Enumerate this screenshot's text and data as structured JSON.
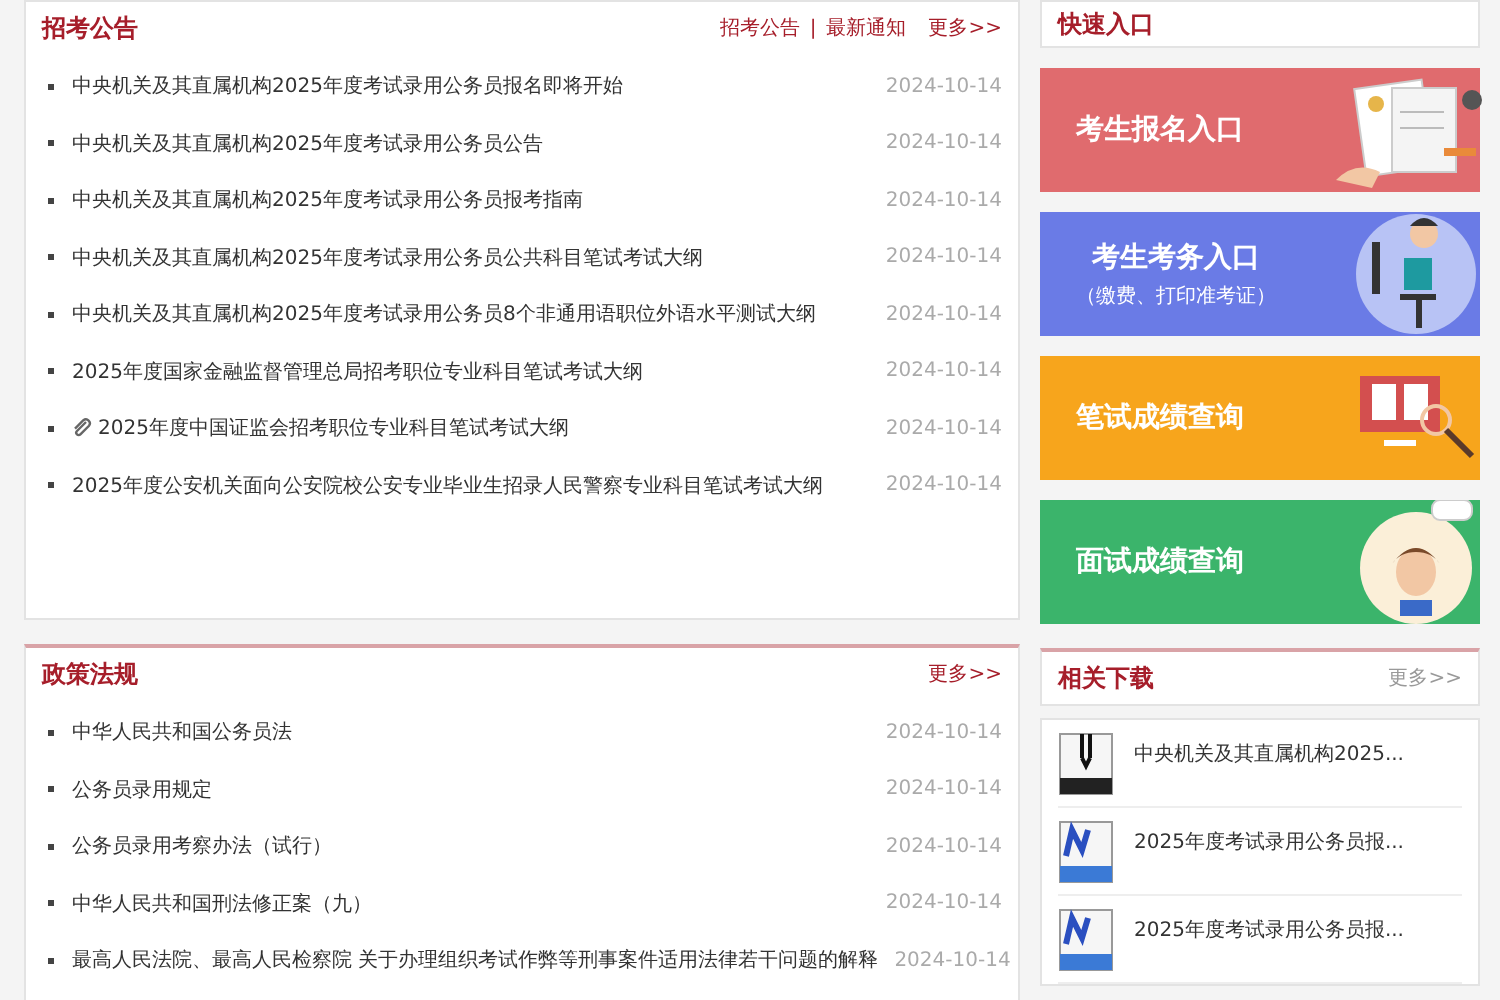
{
  "announcements": {
    "title": "招考公告",
    "links": [
      {
        "label": "招考公告"
      },
      {
        "label": "最新通知"
      }
    ],
    "separator": "|",
    "more": "更多>>",
    "items": [
      {
        "title": "中央机关及其直属机构2025年度考试录用公务员报名即将开始",
        "date": "2024-10-14",
        "attachment": false
      },
      {
        "title": "中央机关及其直属机构2025年度考试录用公务员公告",
        "date": "2024-10-14",
        "attachment": false
      },
      {
        "title": "中央机关及其直属机构2025年度考试录用公务员报考指南",
        "date": "2024-10-14",
        "attachment": false
      },
      {
        "title": "中央机关及其直属机构2025年度考试录用公务员公共科目笔试考试大纲",
        "date": "2024-10-14",
        "attachment": false
      },
      {
        "title": "中央机关及其直属机构2025年度考试录用公务员8个非通用语职位外语水平测试大纲",
        "date": "2024-10-14",
        "attachment": false
      },
      {
        "title": "2025年度国家金融监督管理总局招考职位专业科目笔试考试大纲",
        "date": "2024-10-14",
        "attachment": false
      },
      {
        "title": "2025年度中国证监会招考职位专业科目笔试考试大纲",
        "date": "2024-10-14",
        "attachment": true
      },
      {
        "title": "2025年度公安机关面向公安院校公安专业毕业生招录人民警察专业科目笔试考试大纲",
        "date": "2024-10-14",
        "attachment": false
      }
    ]
  },
  "quick_entry": {
    "title": "快速入口",
    "tiles": [
      {
        "label": "考生报名入口",
        "kind": "form",
        "color": "#e06b6e"
      },
      {
        "label": "考生考务入口",
        "sublabel": "（缴费、打印准考证）",
        "kind": "computer",
        "color": "#6a7be6"
      },
      {
        "label": "笔试成绩查询",
        "kind": "screen",
        "color": "#f7a51c"
      },
      {
        "label": "面试成绩查询",
        "kind": "person",
        "color": "#3bb46b"
      }
    ]
  },
  "policies": {
    "title": "政策法规",
    "more": "更多>>",
    "items": [
      {
        "title": "中华人民共和国公务员法",
        "date": "2024-10-14"
      },
      {
        "title": "公务员录用规定",
        "date": "2024-10-14"
      },
      {
        "title": "公务员录用考察办法（试行）",
        "date": "2024-10-14"
      },
      {
        "title": "中华人民共和国刑法修正案（九）",
        "date": "2024-10-14"
      },
      {
        "title": "最高人民法院、最高人民检察院 关于办理组织考试作弊等刑事案件适用法律若干问题的解释",
        "date": "2024-10-14"
      }
    ]
  },
  "downloads": {
    "title": "相关下载",
    "more": "更多>>",
    "items": [
      {
        "title": "中央机关及其直属机构2025...",
        "kind": "zip"
      },
      {
        "title": "2025年度考试录用公务员报...",
        "kind": "doc"
      },
      {
        "title": "2025年度考试录用公务员报...",
        "kind": "doc"
      }
    ]
  }
}
